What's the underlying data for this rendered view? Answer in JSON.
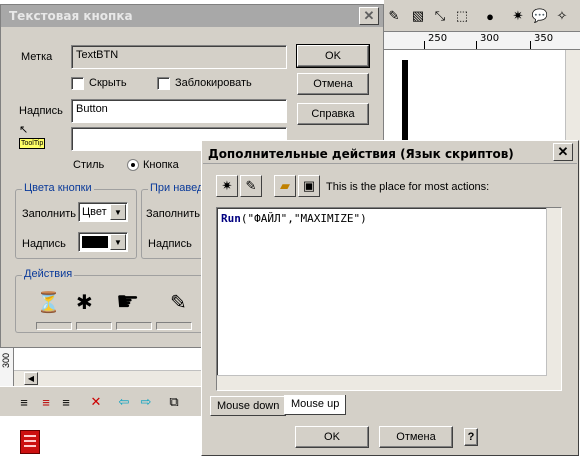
{
  "editor": {
    "ruler_labels": [
      "250",
      "300",
      "350"
    ],
    "left_ruler_label": "300"
  },
  "text_button_dialog": {
    "title": "Текстовая кнопка",
    "label_caption": "Метка",
    "label_value": "TextBTN",
    "hide_label": "Скрыть",
    "block_label": "Заблокировать",
    "caption_label": "Надпись",
    "caption_value": "Button",
    "tooltip_badge": "ToolTip",
    "tooltip_value": "",
    "style_label": "Стиль",
    "style_option": "Кнопка",
    "ok_label": "OK",
    "cancel_label": "Отмена",
    "help_label": "Справка",
    "colors_group": "Цвета кнопки",
    "hover_group": "При навед",
    "fill_label": "Заполнить",
    "fill_value": "Цвет",
    "caption_color_label": "Надпись",
    "fill_label_2": "Заполнить",
    "caption_label_2": "Надпись",
    "actions_group": "Действия",
    "caption_color": "#000000"
  },
  "script_dialog": {
    "title": "Дополнительные действия (Язык скриптов)",
    "hint": "This is the place for most actions:",
    "code_keyword": "Run",
    "code_args": "(\"ФАЙЛ\",\"MAXIMIZE\")",
    "tabs": [
      {
        "label": "Mouse down",
        "active": false
      },
      {
        "label": "Mouse up",
        "active": true
      }
    ],
    "ok_label": "OK",
    "cancel_label": "Отмена",
    "help_icon": "?"
  },
  "colors": {
    "accent_group_title": "#0a3a9a",
    "keyword": "#000080",
    "tooltip_badge": "#ffff66",
    "desktop_icon": "#cc1010"
  }
}
